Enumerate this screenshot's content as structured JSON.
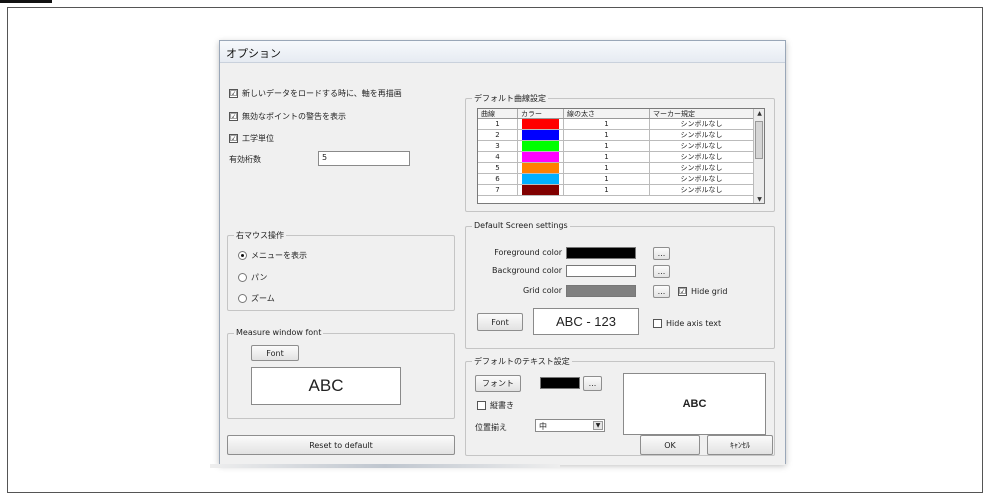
{
  "dialog": {
    "title": "オプション"
  },
  "options": {
    "redraw_label": "新しいデータをロードする時に、軸を再描画",
    "invalid_points_label": "無効なポイントの警告を表示",
    "engineering_units_label": "工学単位",
    "sig_digits_label": "有効桁数",
    "sig_digits_value": "5",
    "redraw_checked": "☑",
    "invalid_checked": "☑",
    "engineering_checked": "☑"
  },
  "right_mouse": {
    "title": "右マウス操作",
    "options": [
      "メニューを表示",
      "パン",
      "ズーム"
    ],
    "selected": "メニューを表示"
  },
  "measure_font": {
    "title": "Measure window font",
    "font_button": "Font",
    "preview": "ABC"
  },
  "curve_settings": {
    "title": "デフォルト曲線設定",
    "columns": [
      "曲線",
      "カラー",
      "線の太さ",
      "マーカー規定"
    ],
    "rows": [
      {
        "curve": "1",
        "color": "#ff0000",
        "width": "1",
        "marker": "シンボルなし"
      },
      {
        "curve": "2",
        "color": "#0000ff",
        "width": "1",
        "marker": "シンボルなし"
      },
      {
        "curve": "3",
        "color": "#00ff00",
        "width": "1",
        "marker": "シンボルなし"
      },
      {
        "curve": "4",
        "color": "#ff00ff",
        "width": "1",
        "marker": "シンボルなし"
      },
      {
        "curve": "5",
        "color": "#ff8000",
        "width": "1",
        "marker": "シンボルなし"
      },
      {
        "curve": "6",
        "color": "#00b0ff",
        "width": "1",
        "marker": "シンボルなし"
      },
      {
        "curve": "7",
        "color": "#800000",
        "width": "1",
        "marker": "シンボルなし"
      }
    ]
  },
  "screen_settings": {
    "title": "Default Screen settings",
    "foreground_label": "Foreground color",
    "background_label": "Background color",
    "grid_label": "Grid color",
    "foreground_color": "#000000",
    "background_color": "#ffffff",
    "grid_color": "#808080",
    "ellipsis": "...",
    "hide_grid_label": "Hide grid",
    "hide_grid_checked": "☑",
    "font_button": "Font",
    "font_preview": "ABC - 123",
    "hide_axis_label": "Hide axis text"
  },
  "text_settings": {
    "title": "デフォルトのテキスト設定",
    "font_button": "フォント",
    "text_color": "#000000",
    "ellipsis": "...",
    "vertical_label": "縦書き",
    "position_label": "位置揃え",
    "position_value": "中",
    "preview": "ABC"
  },
  "footer": {
    "reset_button": "Reset to default",
    "ok_button": "OK",
    "cancel_button": "ｷｬﾝｾﾙ"
  }
}
